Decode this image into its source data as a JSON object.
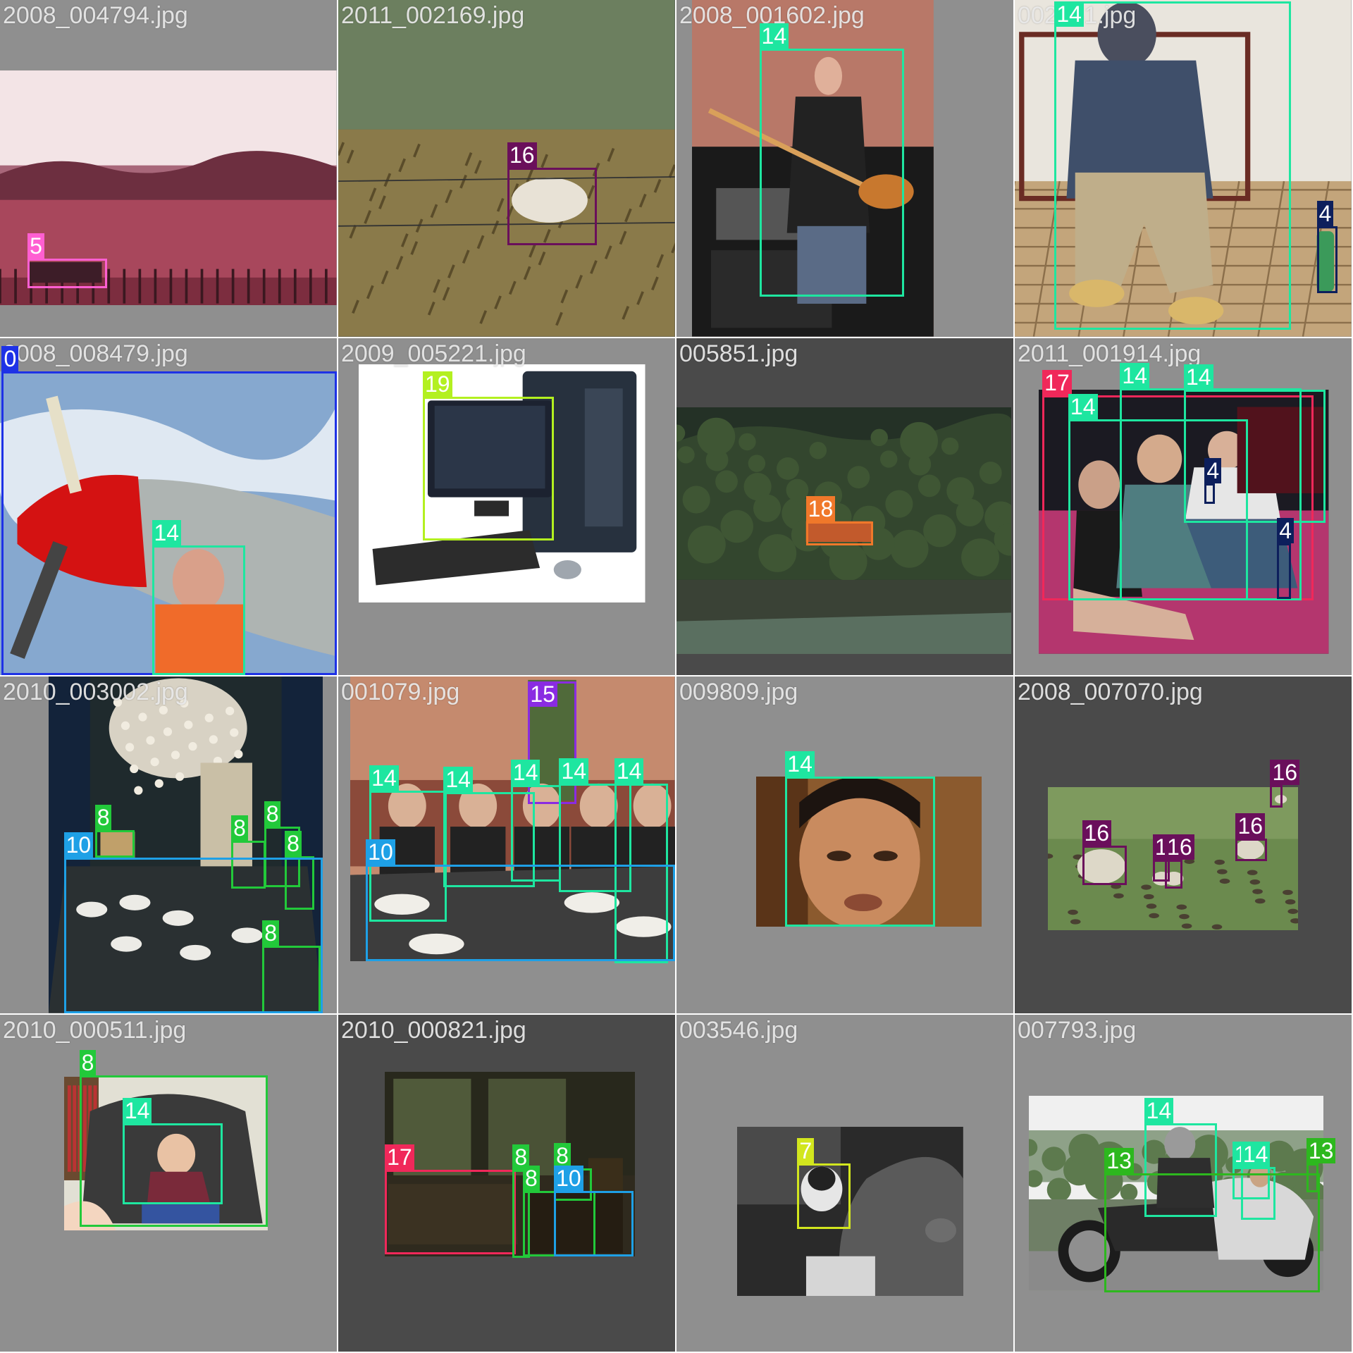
{
  "tiles": [
    {
      "filename": "2008_004794.jpg",
      "background": "#8f8f8f",
      "scene": "pink-tinted-landscape",
      "detections": [
        {
          "label": "5",
          "color": "#ff5fd2"
        }
      ]
    },
    {
      "filename": "2011_002169.jpg",
      "background": "#5a5a5a",
      "scene": "field-with-sheep",
      "detections": [
        {
          "label": "16",
          "color": "#6a0f5b"
        }
      ]
    },
    {
      "filename": "2008_001602.jpg",
      "background": "#8f8f8f",
      "scene": "guitarist-on-stage",
      "detections": [
        {
          "label": "14",
          "color": "#1ee6a0"
        }
      ]
    },
    {
      "filename": "002151.jpg",
      "background": "#8f8f8f",
      "scene": "man-on-bench",
      "detections": [
        {
          "label": "14",
          "color": "#1ee6a0"
        },
        {
          "label": "4",
          "color": "#0d1f5c"
        }
      ]
    },
    {
      "filename": "2008_008479.jpg",
      "background": "#8f8f8f",
      "scene": "propeller-plane",
      "detections": [
        {
          "label": "0",
          "color": "#1e32e6"
        },
        {
          "label": "14",
          "color": "#1ee6a0"
        }
      ]
    },
    {
      "filename": "2009_005221.jpg",
      "background": "#8f8f8f",
      "scene": "desktop-computer",
      "detections": [
        {
          "label": "19",
          "color": "#b3f020"
        }
      ]
    },
    {
      "filename": "005851.jpg",
      "background": "#4a4a4a",
      "scene": "forest-train",
      "detections": [
        {
          "label": "18",
          "color": "#f0782a"
        }
      ]
    },
    {
      "filename": "2011_001914.jpg",
      "background": "#8f8f8f",
      "scene": "group-on-couch",
      "detections": [
        {
          "label": "17",
          "color": "#f0285a"
        },
        {
          "label": "14",
          "color": "#1ee6a0"
        },
        {
          "label": "14",
          "color": "#1ee6a0"
        },
        {
          "label": "14",
          "color": "#1ee6a0"
        },
        {
          "label": "4",
          "color": "#0d1f5c"
        },
        {
          "label": "4",
          "color": "#0d1f5c"
        }
      ]
    },
    {
      "filename": "2010_003002.jpg",
      "background": "#8f8f8f",
      "scene": "dining-room",
      "detections": [
        {
          "label": "8",
          "color": "#22c93a"
        },
        {
          "label": "8",
          "color": "#22c93a"
        },
        {
          "label": "8",
          "color": "#22c93a"
        },
        {
          "label": "8",
          "color": "#22c93a"
        },
        {
          "label": "8",
          "color": "#22c93a"
        },
        {
          "label": "10",
          "color": "#1ea0e6"
        }
      ]
    },
    {
      "filename": "001079.jpg",
      "background": "#8f8f8f",
      "scene": "restaurant-group",
      "detections": [
        {
          "label": "15",
          "color": "#8a2be2"
        },
        {
          "label": "14",
          "color": "#1ee6a0"
        },
        {
          "label": "14",
          "color": "#1ee6a0"
        },
        {
          "label": "14",
          "color": "#1ee6a0"
        },
        {
          "label": "14",
          "color": "#1ee6a0"
        },
        {
          "label": "14",
          "color": "#1ee6a0"
        },
        {
          "label": "10",
          "color": "#1ea0e6"
        }
      ]
    },
    {
      "filename": "009809.jpg",
      "background": "#8f8f8f",
      "scene": "face-closeup",
      "detections": [
        {
          "label": "14",
          "color": "#1ee6a0"
        }
      ]
    },
    {
      "filename": "2008_007070.jpg",
      "background": "#4a4a4a",
      "scene": "sheep-pasture",
      "detections": [
        {
          "label": "16",
          "color": "#6a0f5b"
        },
        {
          "label": "16",
          "color": "#6a0f5b"
        },
        {
          "label": "16",
          "color": "#6a0f5b"
        },
        {
          "label": "16",
          "color": "#6a0f5b"
        },
        {
          "label": "16",
          "color": "#6a0f5b"
        }
      ]
    },
    {
      "filename": "2010_000511.jpg",
      "background": "#8f8f8f",
      "scene": "baby-in-chair",
      "detections": [
        {
          "label": "8",
          "color": "#22c93a"
        },
        {
          "label": "14",
          "color": "#1ee6a0"
        }
      ]
    },
    {
      "filename": "2010_000821.jpg",
      "background": "#4a4a4a",
      "scene": "dark-living-room",
      "detections": [
        {
          "label": "17",
          "color": "#f0285a"
        },
        {
          "label": "8",
          "color": "#22c93a"
        },
        {
          "label": "8",
          "color": "#22c93a"
        },
        {
          "label": "8",
          "color": "#22c93a"
        },
        {
          "label": "10",
          "color": "#1ea0e6"
        }
      ]
    },
    {
      "filename": "003546.jpg",
      "background": "#8f8f8f",
      "scene": "cat-and-rabbit",
      "detections": [
        {
          "label": "7",
          "color": "#d2e61e"
        }
      ]
    },
    {
      "filename": "007793.jpg",
      "background": "#8f8f8f",
      "scene": "motorcycle-sidecar",
      "detections": [
        {
          "label": "14",
          "color": "#1ee6a0"
        },
        {
          "label": "14",
          "color": "#1ee6a0"
        },
        {
          "label": "14",
          "color": "#1ee6a0"
        },
        {
          "label": "13",
          "color": "#2db81e"
        },
        {
          "label": "13",
          "color": "#2db81e"
        }
      ]
    }
  ]
}
